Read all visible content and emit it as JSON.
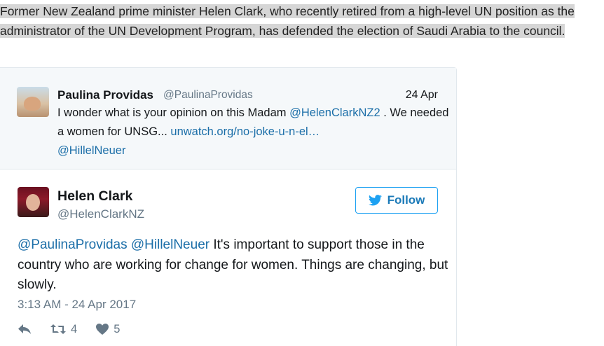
{
  "article": {
    "paragraph": "Former New Zealand prime minister Helen Clark, who recently retired from a high-level UN position as the administrator of the UN Development Program, has defended the election of Saudi Arabia to the council."
  },
  "quoted_tweet": {
    "name": "Paulina Providas",
    "handle": "@PaulinaProvidas",
    "date": "24 Apr",
    "text_1": "I wonder what is your opinion on this Madam ",
    "mention_1": "@HelenClarkNZ2",
    "text_2": " . We needed a women for UNSG... ",
    "link": "unwatch.org/no-joke-u-n-el…",
    "mention_2": "@HillelNeuer"
  },
  "tweet": {
    "name": "Helen Clark",
    "handle": "@HelenClarkNZ",
    "follow_label": "Follow",
    "mention_1": "@PaulinaProvidas",
    "mention_2": "@HillelNeuer",
    "text": " It's important to support those in the country who are working for change for women. Things are changing, but slowly.",
    "timestamp": "3:13 AM - 24 Apr 2017",
    "retweets": "4",
    "likes": "5"
  },
  "icons": {
    "follow": "twitter-bird-icon",
    "reply": "reply-icon",
    "retweet": "retweet-icon",
    "like": "heart-icon"
  },
  "colors": {
    "link": "#1b6ea8",
    "twitter_blue": "#1da1f2",
    "muted": "#657786",
    "highlight": "#d6d6d6"
  }
}
